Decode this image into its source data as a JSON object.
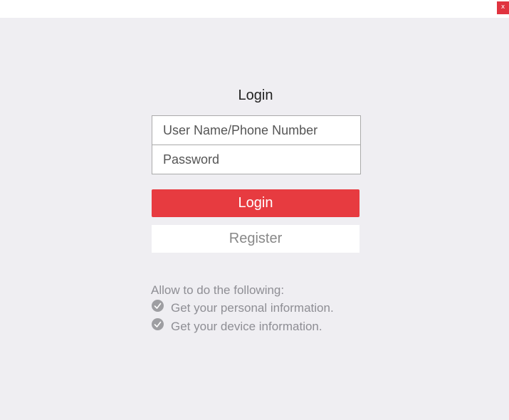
{
  "window": {
    "close_label": "x",
    "close_icon": "close-icon",
    "accent_color": "#e73b40"
  },
  "login": {
    "title": "Login",
    "username_placeholder": "User Name/Phone Number",
    "username_value": "",
    "password_placeholder": "Password",
    "password_value": "",
    "login_label": "Login",
    "register_label": "Register"
  },
  "permissions": {
    "title": "Allow to do the following:",
    "icon": "check-circle-icon",
    "items": [
      "Get your personal information.",
      "Get your device information."
    ]
  }
}
